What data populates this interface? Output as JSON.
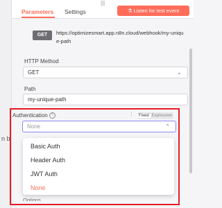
{
  "left_panel": {
    "snippet": "n by"
  },
  "tabs": [
    {
      "label": "Parameters",
      "active": true
    },
    {
      "label": "Settings",
      "active": false
    }
  ],
  "top_handle": "|||",
  "listen_button": {
    "icon": "flask-icon",
    "label": "Listen for test event"
  },
  "webhook": {
    "method_badge": "GET",
    "url": "https://optimizesmart.app.n8n.cloud/webhook/my-unique-path"
  },
  "http_method": {
    "label": "HTTP Method",
    "value": "GET"
  },
  "path": {
    "label": "Path",
    "value": "my-unique-path"
  },
  "authentication": {
    "label": "Authentication",
    "mode_fixed": "Fixed",
    "mode_expression": "Expression",
    "placeholder": "None",
    "options": [
      {
        "label": "Basic Auth",
        "selected": false
      },
      {
        "label": "Header Auth",
        "selected": false
      },
      {
        "label": "JWT Auth",
        "selected": false
      },
      {
        "label": "None",
        "selected": true
      }
    ]
  },
  "options_label": "Options",
  "colors": {
    "accent": "#ff6d5a",
    "highlight_frame": "#e51c23",
    "badge": "#6d6d72"
  }
}
